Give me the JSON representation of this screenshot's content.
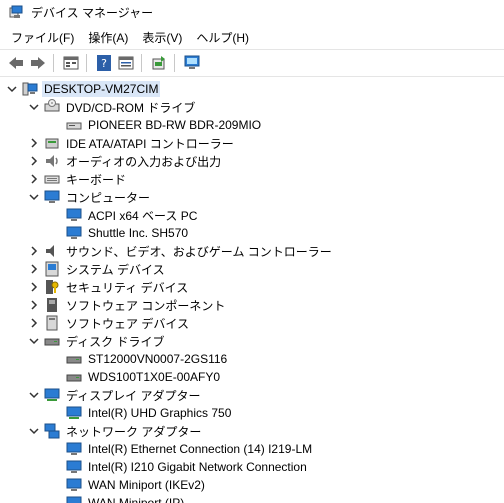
{
  "window": {
    "title": "デバイス マネージャー"
  },
  "menu": [
    {
      "label": "ファイル(F)"
    },
    {
      "label": "操作(A)"
    },
    {
      "label": "表示(V)"
    },
    {
      "label": "ヘルプ(H)"
    }
  ],
  "toolbar": {
    "buttons": [
      "back-arrow-icon",
      "forward-arrow-icon",
      "properties-icon",
      "help-icon",
      "view-icon",
      "update-driver-icon",
      "scan-hardware-icon"
    ]
  },
  "tree": {
    "root": "DESKTOP-VM27CIM",
    "nodes": [
      {
        "label": "DVD/CD-ROM ドライブ",
        "expanded": true,
        "icon": "dvd-drive-icon",
        "children": [
          "PIONEER BD-RW BDR-209MIO"
        ]
      },
      {
        "label": "IDE ATA/ATAPI コントローラー",
        "expanded": false,
        "icon": "ide-controller-icon"
      },
      {
        "label": "オーディオの入力および出力",
        "expanded": false,
        "icon": "audio-icon"
      },
      {
        "label": "キーボード",
        "expanded": false,
        "icon": "keyboard-icon"
      },
      {
        "label": "コンピューター",
        "expanded": true,
        "icon": "computer-icon",
        "children": [
          "ACPI x64 ベース PC",
          "Shuttle Inc. SH570"
        ]
      },
      {
        "label": "サウンド、ビデオ、およびゲーム コントローラー",
        "expanded": false,
        "icon": "sound-icon"
      },
      {
        "label": "システム デバイス",
        "expanded": false,
        "icon": "system-device-icon"
      },
      {
        "label": "セキュリティ デバイス",
        "expanded": false,
        "icon": "security-device-icon"
      },
      {
        "label": "ソフトウェア コンポーネント",
        "expanded": false,
        "icon": "software-component-icon"
      },
      {
        "label": "ソフトウェア デバイス",
        "expanded": false,
        "icon": "software-device-icon"
      },
      {
        "label": "ディスク ドライブ",
        "expanded": true,
        "icon": "disk-drive-icon",
        "children": [
          "ST12000VN0007-2GS116",
          "WDS100T1X0E-00AFY0"
        ]
      },
      {
        "label": "ディスプレイ アダプター",
        "expanded": true,
        "icon": "display-adapter-icon",
        "children": [
          "Intel(R) UHD Graphics 750"
        ]
      },
      {
        "label": "ネットワーク アダプター",
        "expanded": true,
        "icon": "network-adapter-icon",
        "children": [
          "Intel(R) Ethernet Connection (14) I219-LM",
          "Intel(R) I210 Gigabit Network Connection",
          "WAN Miniport (IKEv2)",
          "WAN Miniport (IP)"
        ]
      }
    ]
  },
  "colors": {
    "selection": "#d9e6f7",
    "monitor_blue": "#2b7cd3",
    "chevron": "#333333"
  }
}
